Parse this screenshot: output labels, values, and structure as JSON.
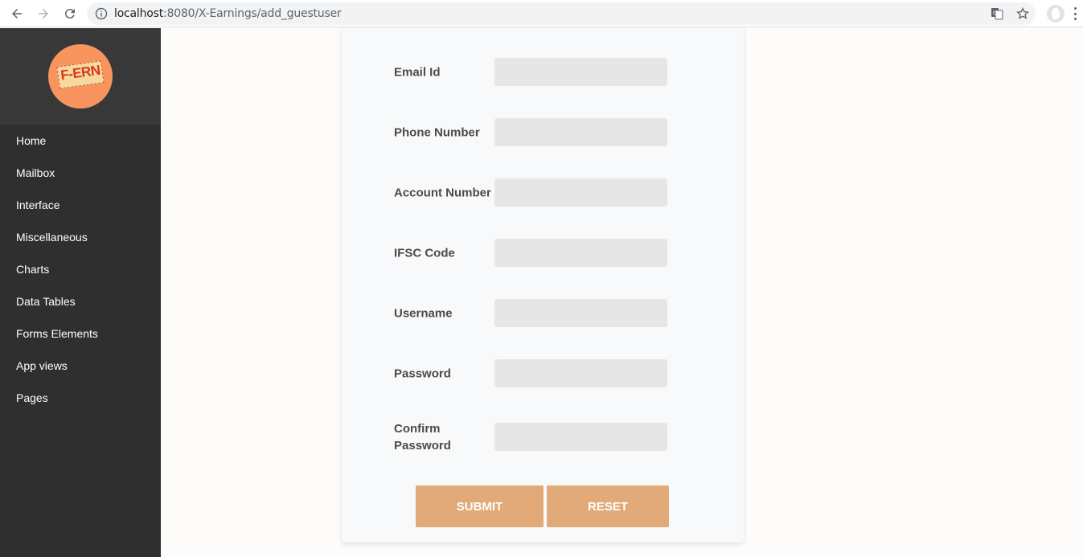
{
  "browser": {
    "url_host": "localhost",
    "url_rest": ":8080/X-Earnings/add_guestuser",
    "icons": [
      "back-icon",
      "forward-icon",
      "reload-icon",
      "info-icon",
      "translate-icon",
      "star-icon",
      "profile-icon",
      "more-icon"
    ]
  },
  "sidebar": {
    "logo_text": "F-ERN",
    "items": [
      {
        "label": "Home"
      },
      {
        "label": "Mailbox"
      },
      {
        "label": "Interface"
      },
      {
        "label": "Miscellaneous"
      },
      {
        "label": "Charts"
      },
      {
        "label": "Data Tables"
      },
      {
        "label": "Forms Elements"
      },
      {
        "label": "App views"
      },
      {
        "label": "Pages"
      }
    ]
  },
  "form": {
    "fields": [
      {
        "label": "Email Id",
        "value": ""
      },
      {
        "label": "Phone Number",
        "value": ""
      },
      {
        "label": "Account Number",
        "value": ""
      },
      {
        "label": "IFSC Code",
        "value": ""
      },
      {
        "label": "Username",
        "value": ""
      },
      {
        "label": "Password",
        "value": ""
      },
      {
        "label": "Confirm Password",
        "value": ""
      }
    ],
    "submit_label": "SUBMIT",
    "reset_label": "RESET"
  },
  "colors": {
    "sidebar_bg": "#2f2f2f",
    "logo_area_bg": "#383838",
    "logo_circle": "#f8955e",
    "button_bg": "#e1aa78",
    "field_bg": "#e6e6e6",
    "card_bg": "#f8f9fa"
  }
}
